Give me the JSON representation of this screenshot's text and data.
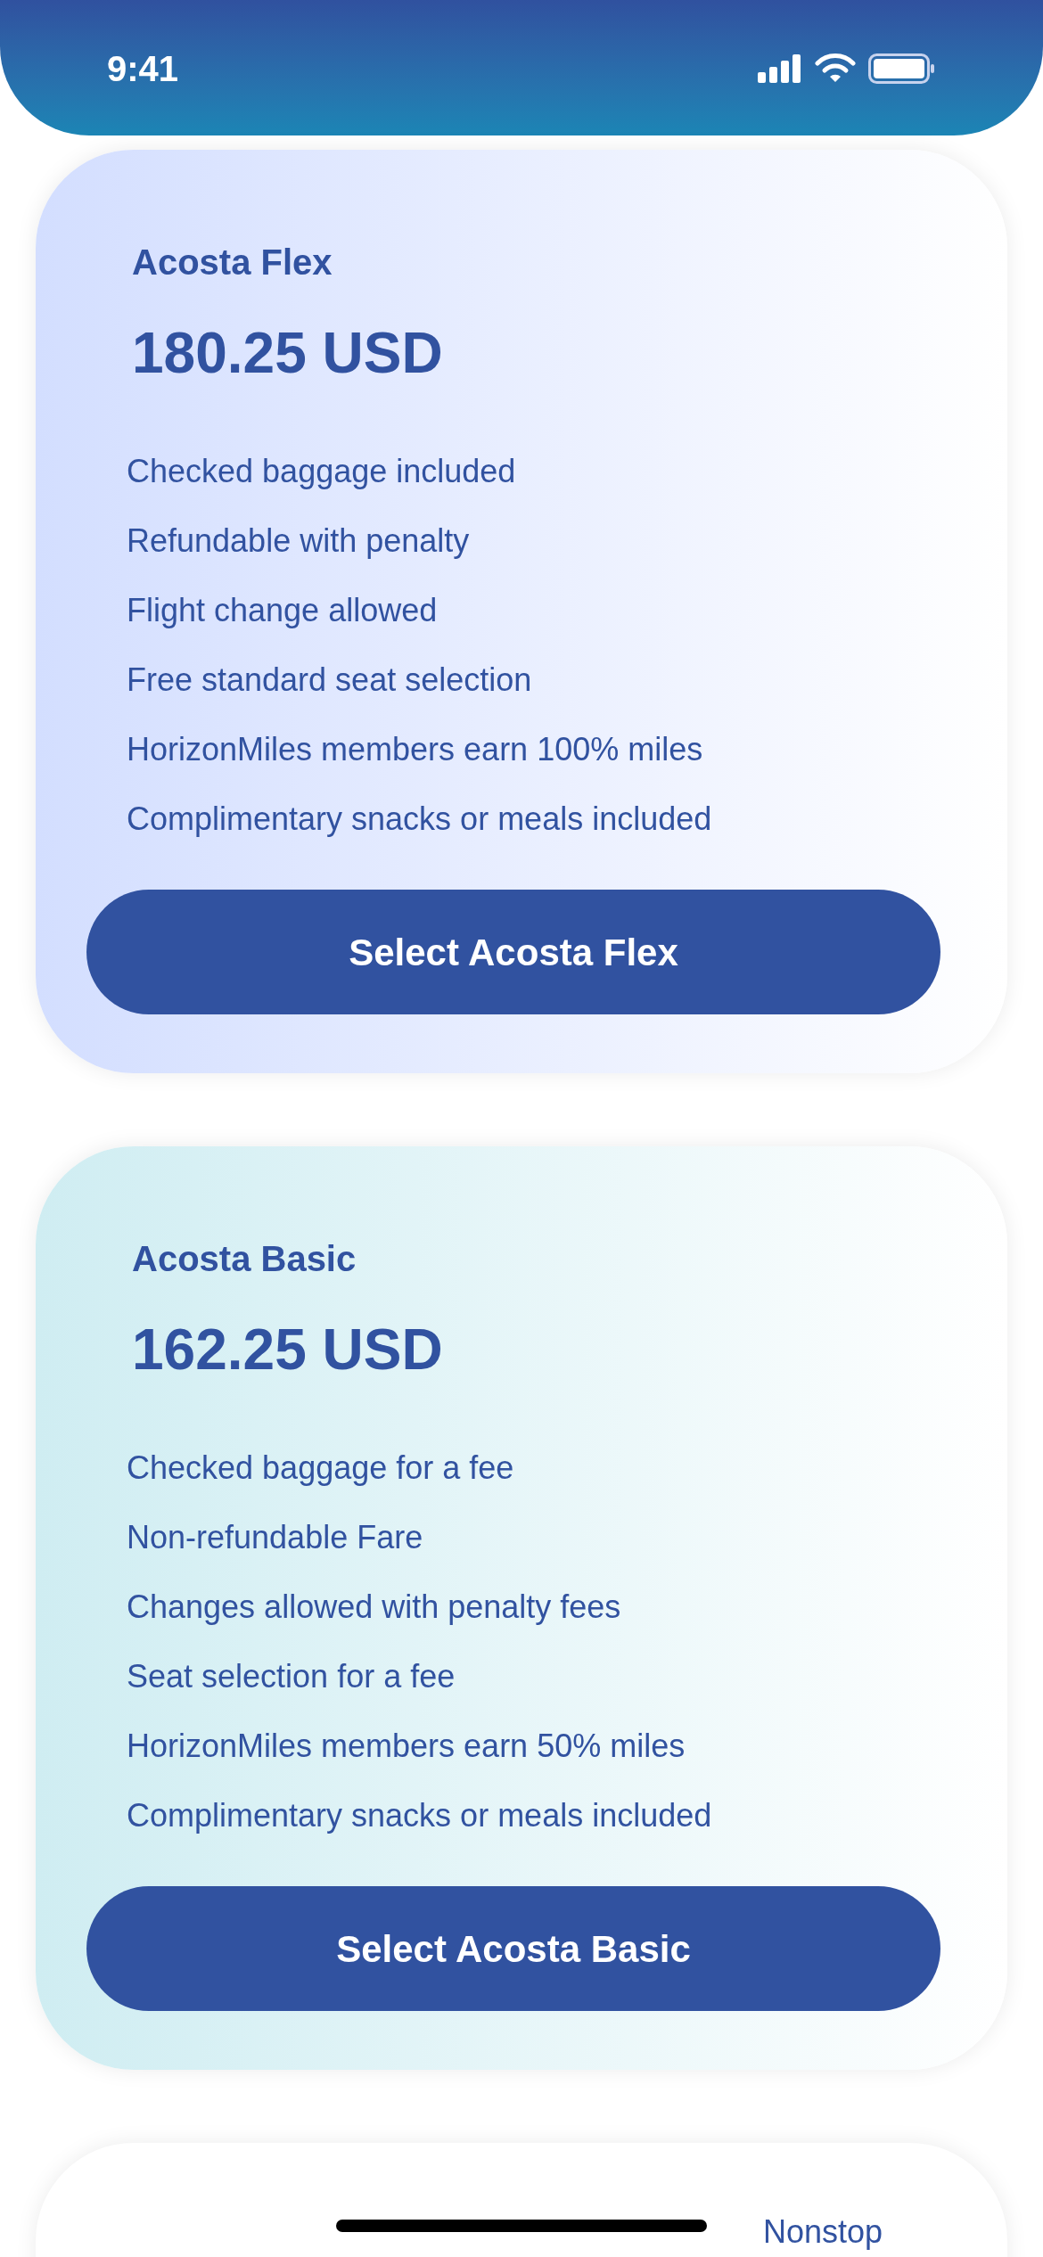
{
  "status_bar": {
    "time": "9:41"
  },
  "fares": [
    {
      "name": "Acosta Flex",
      "price": "180.25 USD",
      "color": "#d3deff",
      "features": [
        "Checked baggage included",
        "Refundable with penalty",
        "Flight change allowed",
        "Free standard seat selection",
        "HorizonMiles members earn 100% miles",
        "Complimentary snacks or meals included"
      ],
      "button": "Select Acosta Flex"
    },
    {
      "name": "Acosta Basic",
      "price": "162.25 USD",
      "color": "#cfedf2",
      "features": [
        "Checked baggage for a fee",
        "Non-refundable Fare",
        "Changes allowed with penalty fees",
        "Seat selection for a fee",
        "HorizonMiles members earn 50% miles",
        "Complimentary snacks or meals included"
      ],
      "button": "Select Acosta Basic"
    }
  ],
  "next_card": {
    "tag": "Nonstop"
  }
}
